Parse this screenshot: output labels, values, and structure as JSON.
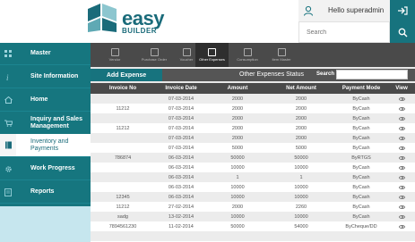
{
  "brand": {
    "name": "easy",
    "sub": "BUILDER"
  },
  "user": {
    "greeting": "Hello superadmin"
  },
  "search": {
    "placeholder": "Search"
  },
  "sidebar": {
    "items": [
      {
        "label": "Master",
        "icon": "grid-icon"
      },
      {
        "label": "Site Information",
        "icon": "info-icon"
      },
      {
        "label": "Home",
        "icon": "home-icon"
      },
      {
        "label": "Inquiry and Sales Management",
        "icon": "cart-icon"
      },
      {
        "label": "Inventory and Payments",
        "icon": "book-icon"
      },
      {
        "label": "Work Progress",
        "icon": "gear-icon"
      },
      {
        "label": "Reports",
        "icon": "report-icon"
      }
    ]
  },
  "toolbar": {
    "items": [
      {
        "label": "Vendor"
      },
      {
        "label": "Purchase Order"
      },
      {
        "label": "Voucher"
      },
      {
        "label": "Other Expenses"
      },
      {
        "label": "Consumption"
      },
      {
        "label": "Item Master"
      }
    ]
  },
  "actions": {
    "add_label": "Add Expense",
    "status_label": "Other Expenses Status",
    "search_label": "Search"
  },
  "table": {
    "headers": [
      "Invoice No",
      "Invoice Date",
      "Amount",
      "Net Amount",
      "Payment Mode",
      "View"
    ],
    "rows": [
      [
        "",
        "07-03-2014",
        "2000",
        "2000",
        "ByCash"
      ],
      [
        "11212",
        "07-03-2014",
        "2000",
        "2000",
        "ByCash"
      ],
      [
        "",
        "07-03-2014",
        "2000",
        "2000",
        "ByCash"
      ],
      [
        "11212",
        "07-03-2014",
        "2000",
        "2000",
        "ByCash"
      ],
      [
        "",
        "07-03-2014",
        "2000",
        "2000",
        "ByCash"
      ],
      [
        "",
        "07-03-2014",
        "5000",
        "5000",
        "ByCash"
      ],
      [
        "786874",
        "06-03-2014",
        "50000",
        "50000",
        "ByRTGS"
      ],
      [
        "",
        "06-03-2014",
        "10000",
        "10000",
        "ByCash"
      ],
      [
        "",
        "06-03-2014",
        "1",
        "1",
        "ByCash"
      ],
      [
        "",
        "06-03-2014",
        "10000",
        "10000",
        "ByCash"
      ],
      [
        "12345",
        "06-03-2014",
        "10000",
        "10000",
        "ByCash"
      ],
      [
        "11212",
        "27-02-2014",
        "2000",
        "2260",
        "ByCash"
      ],
      [
        "sadg",
        "13-02-2014",
        "10000",
        "10000",
        "ByCash"
      ],
      [
        "7894561230",
        "11-02-2014",
        "50000",
        "54000",
        "ByCheque/DD"
      ],
      [
        "",
        "",
        "",
        "",
        ""
      ]
    ]
  },
  "colors": {
    "accent": "#17737e",
    "dark": "#4a4a4a",
    "light": "#c6e6ee"
  }
}
